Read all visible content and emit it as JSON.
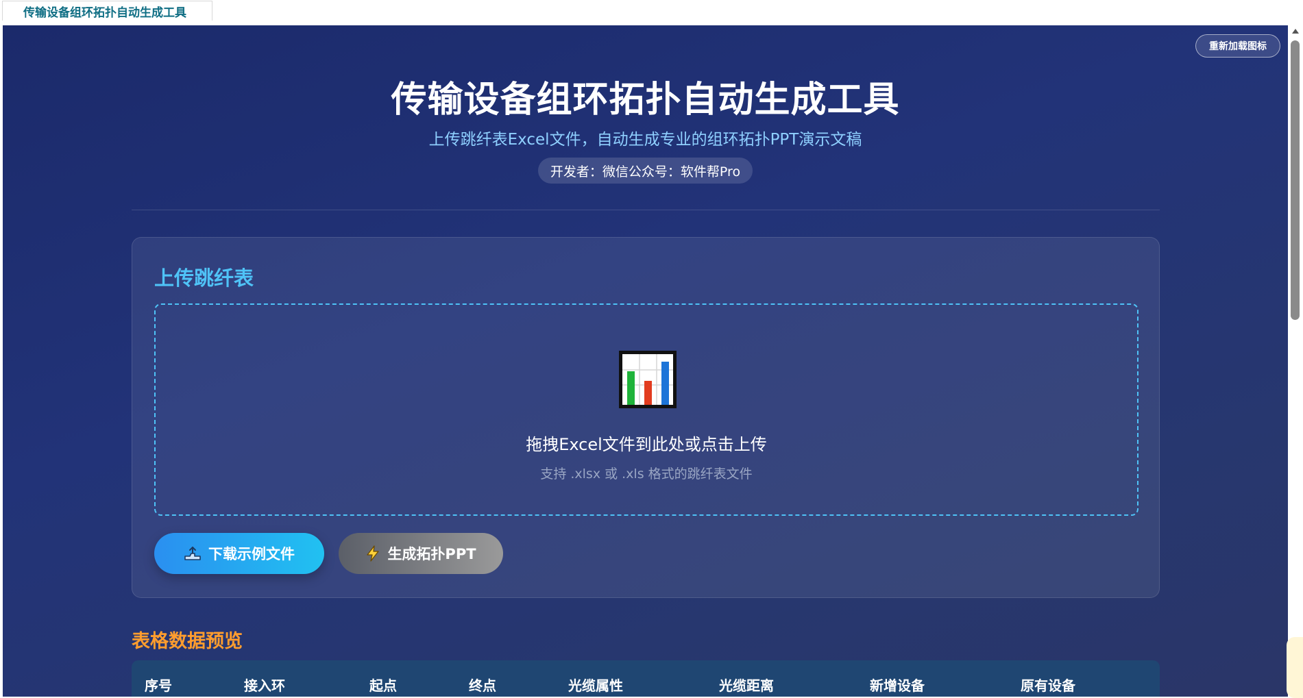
{
  "tab": {
    "title": "传输设备组环拓扑自动生成工具"
  },
  "header": {
    "reload_label": "重新加载图标",
    "title": "传输设备组环拓扑自动生成工具",
    "subtitle": "上传跳纤表Excel文件，自动生成专业的组环拓扑PPT演示文稿",
    "developer": "开发者：微信公众号：软件帮Pro"
  },
  "upload": {
    "section_title": "上传跳纤表",
    "icon": "bar-chart-icon",
    "drop_text": "拖拽Excel文件到此处或点击上传",
    "hint": "支持 .xlsx 或 .xls 格式的跳纤表文件",
    "download_label": "下载示例文件",
    "download_icon": "hand-upload-icon",
    "generate_label": "生成拓扑PPT",
    "generate_icon": "lightning-icon"
  },
  "preview": {
    "title": "表格数据预览",
    "columns": [
      "序号",
      "接入环",
      "起点",
      "终点",
      "光缆属性",
      "光缆距离",
      "新增设备",
      "原有设备"
    ]
  },
  "colors": {
    "accent": "#4fc3f7",
    "preview_title": "#ff9d2e",
    "background": "#1b2a6b",
    "table_header": "#1f4672"
  }
}
